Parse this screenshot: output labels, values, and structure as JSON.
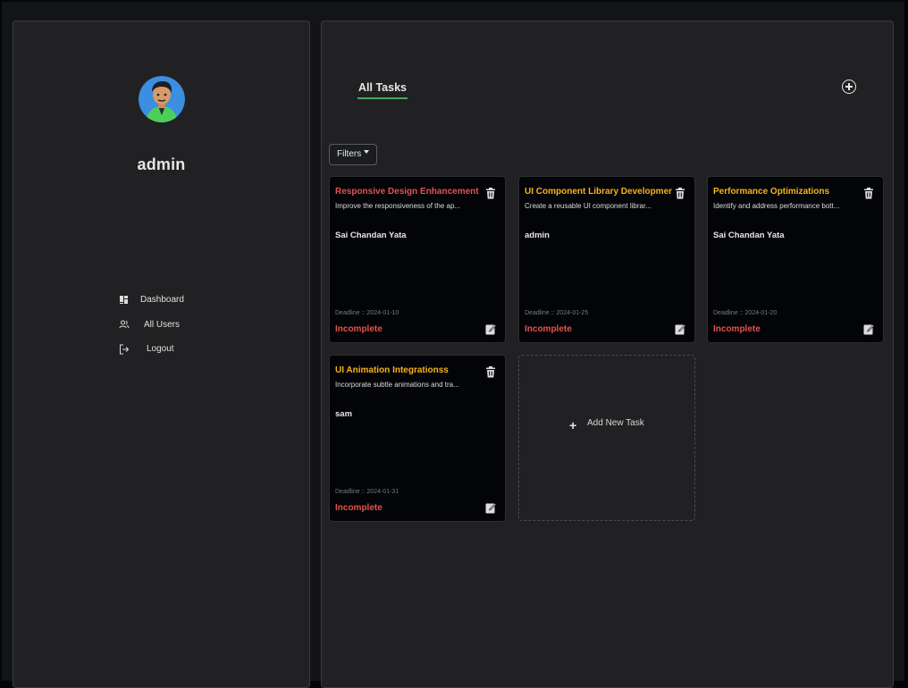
{
  "user": {
    "name": "admin"
  },
  "nav": [
    {
      "label": "Dashboard",
      "icon": "dashboard-icon"
    },
    {
      "label": "All Users",
      "icon": "users-icon"
    },
    {
      "label": "Logout",
      "icon": "logout-icon"
    }
  ],
  "main": {
    "tab_label": "All Tasks",
    "filters_label": "Filters",
    "add_new_label": "Add New Task",
    "add_new_icon": "+"
  },
  "colors": {
    "accent_green": "#46a764",
    "title_red": "#e4524e",
    "title_yellow": "#f4b41a",
    "status_red": "#e4524e"
  },
  "tasks": [
    {
      "title": "Responsive Design Enhancement",
      "title_color": "#e4524e",
      "description": "Improve the responsiveness of the ap...",
      "assignee": "Sai Chandan Yata",
      "deadline": "Deadline :: 2024-01-10",
      "status": "Incomplete"
    },
    {
      "title": "UI Component Library Development",
      "title_color": "#f4b41a",
      "description": "Create a reusable UI component librar...",
      "assignee": "admin",
      "deadline": "Deadline :: 2024-01-25",
      "status": "Incomplete"
    },
    {
      "title": "Performance Optimizations",
      "title_color": "#f4b41a",
      "description": "Identify and address performance bott...",
      "assignee": "Sai Chandan Yata",
      "deadline": "Deadline :: 2024-01-20",
      "status": "Incomplete"
    },
    {
      "title": "UI Animation Integrationss",
      "title_color": "#f4b41a",
      "description": "Incorporate subtle animations and tra...",
      "assignee": "sam",
      "deadline": "Deadline :: 2024-01-31",
      "status": "Incomplete"
    }
  ]
}
